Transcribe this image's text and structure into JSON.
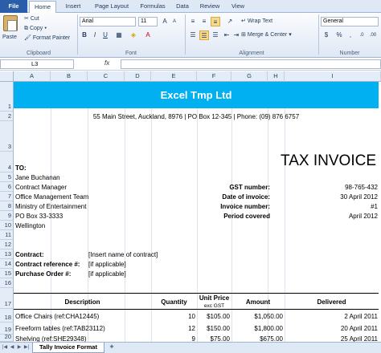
{
  "ribbon_tabs": [
    "File",
    "Home",
    "Insert",
    "Page Layout",
    "Formulas",
    "Data",
    "Review",
    "View"
  ],
  "clipboard": {
    "paste": "Paste",
    "cut": "Cut",
    "copy": "Copy",
    "format_painter": "Format Painter",
    "label": "Clipboard"
  },
  "font": {
    "name": "Arial",
    "size": "11",
    "bold": "B",
    "italic": "I",
    "underline": "U",
    "label": "Font"
  },
  "alignment": {
    "wrap_text": "Wrap Text",
    "merge_center": "Merge & Center",
    "label": "Alignment"
  },
  "number": {
    "format": "General",
    "currency": "$",
    "percent": "%",
    "label": "Number"
  },
  "formula_bar": {
    "name_box": "L3",
    "fx": "fx"
  },
  "columns": [
    "A",
    "B",
    "C",
    "D",
    "E",
    "F",
    "G",
    "H",
    "I"
  ],
  "rows": [
    "1",
    "2",
    "3",
    "4",
    "5",
    "6",
    "7",
    "8",
    "9",
    "10",
    "11",
    "12",
    "13",
    "14",
    "15",
    "16",
    "17",
    "18",
    "19",
    "20"
  ],
  "sheet": {
    "company": "Excel Tmp Ltd",
    "address": "55 Main Street, Auckland, 8976 | PO Box 12-345 | Phone: (09) 876 6757",
    "tax_invoice": "TAX INVOICE",
    "to_label": "TO:",
    "recipient": [
      "Jane Buchanan",
      "Contract Manager",
      "Office Management Team",
      "Ministry of Entertainment",
      "PO Box 33-3333",
      "Wellington"
    ],
    "info": [
      {
        "label": "GST number:",
        "value": "98-765-432"
      },
      {
        "label": "Date of invoice:",
        "value": "30 April 2012"
      },
      {
        "label": "Invoice number:",
        "value": "#1"
      },
      {
        "label": "Period covered",
        "value": "April 2012"
      }
    ],
    "contract_label": "Contract:",
    "contract_value": "[Insert name of contract]",
    "contract_ref_label": "Contract reference #:",
    "contract_ref_value": "[if applicable]",
    "po_label": "Purchase Order #:",
    "po_value": "[if applicable]",
    "headers": {
      "description": "Description",
      "quantity": "Quantity",
      "unit_price": "Unit Price",
      "unit_price_sub": "exc GST",
      "amount": "Amount",
      "delivered": "Delivered"
    },
    "items": [
      {
        "description": "Office Chairs (ref:CHA12445)",
        "quantity": "10",
        "unit_price": "$105.00",
        "amount": "$1,050.00",
        "delivered": "2 April 2011"
      },
      {
        "description": "Freeform tables (ref:TAB23112)",
        "quantity": "12",
        "unit_price": "$150.00",
        "amount": "$1,800.00",
        "delivered": "20 April 2011"
      },
      {
        "description": "Shelving (ref:SHE29348)",
        "quantity": "9",
        "unit_price": "$75.00",
        "amount": "$675.00",
        "delivered": "25 April 2011"
      }
    ]
  },
  "sheet_tab": "Tally Invoice Format"
}
